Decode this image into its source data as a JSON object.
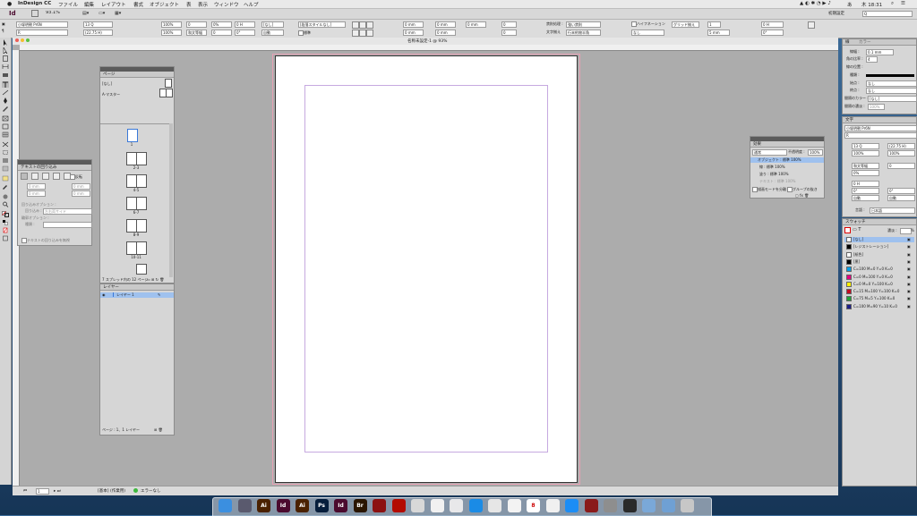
{
  "menubar": {
    "apple": "",
    "app_name": "InDesign CC",
    "items": [
      "ファイル",
      "編集",
      "レイアウト",
      "書式",
      "オブジェクト",
      "表",
      "表示",
      "ウィンドウ",
      "ヘルプ"
    ],
    "clock": "木 18:31",
    "input_method": "あ"
  },
  "app_bar": {
    "logo": "Id",
    "zoom": "93.1%",
    "workspace": "初期設定",
    "search_placeholder": "Q"
  },
  "control_panel": {
    "font_family": "小塚明朝 Pr6N",
    "font_style": "R",
    "font_size": "13 Q",
    "leading": "(22.75 H)",
    "scale_h": "100%",
    "scale_v": "100%",
    "tracking": "0",
    "kerning": "和文等幅",
    "tsume": "0%",
    "aki": "0",
    "baseline": "0 H",
    "skew": "0°",
    "style_none": "[なし]",
    "char_style": "[なし]",
    "stroke_opts": "自動",
    "standard": "標準",
    "para_style": "[段落スタイルなし]",
    "indent_l": "0 mm",
    "indent_r": "0 mm",
    "indent_first": "0 mm",
    "space_before": "0 mm",
    "space_after": "0 mm",
    "drop_lines": "0",
    "drop_chars": "0",
    "kinsoku": "強い禁則",
    "mojikumi": "行末約物半角",
    "hyphen_label": "ハイフネーション",
    "grid_label": "グリッド揃え",
    "align_to": "なし",
    "cols": "1",
    "col_gap": "5 mm",
    "lang_label": "文字揃え"
  },
  "document": {
    "title": "名称未設定-1 @ 93%"
  },
  "statusbar": {
    "page": "1",
    "preflight_label": "[基本] (作業用)",
    "errors": "エラーなし"
  },
  "text_wrap_panel": {
    "title": "テキストの回り込み",
    "invert_label": "反転",
    "offset_top": "0 mm",
    "offset_bottom": "0 mm",
    "offset_left": "0 mm",
    "offset_right": "0 mm",
    "wrap_options_label": "回り込みオプション :",
    "wrap_to_label": "回り込み :",
    "wrap_to_value": "左右両サイド",
    "contour_options_label": "輪郭オプション :",
    "contour_type_label": "種類 :",
    "ignore_label": "テキストの回り込みを無視"
  },
  "pages_panel": {
    "title": "ページ",
    "none_label": "[なし]",
    "master_label": "A-マスター",
    "page_labels": [
      "1",
      "2-3",
      "4-5",
      "6-7",
      "8-9",
      "10-11",
      "12"
    ],
    "footer": "7 スプレッド内の 12 ページ"
  },
  "layers_panel": {
    "title": "レイヤー",
    "layer_name": "レイヤー 1",
    "footer": "ページ : 1、1 レイヤー"
  },
  "effects_panel": {
    "title": "効果",
    "blend_mode": "通常",
    "opacity_label": "不透明度 :",
    "opacity": "100%",
    "rows": [
      {
        "label": "オブジェクト : 標準 100%"
      },
      {
        "label": "線 : 標準 100%"
      },
      {
        "label": "塗り : 標準 100%"
      },
      {
        "label": "テキスト : 標準 100%"
      }
    ],
    "isolate_label": "描画モードを分離",
    "knockout_label": "グループの抜き"
  },
  "stroke_panel": {
    "tab_stroke": "線",
    "tab_color": "カラー",
    "weight_label": "線幅 :",
    "weight": "0.1 mm",
    "miter_label": "角の比率 :",
    "miter": "4",
    "align_label": "線の位置 :",
    "type_label": "種類 :",
    "start_label": "始点 :",
    "start": "なし",
    "end_label": "終点 :",
    "end": "なし",
    "gap_color_label": "間隔のカラー :",
    "gap_color": "[なし]",
    "gap_tint_label": "間隔の濃淡 :",
    "gap_tint": "100%"
  },
  "char_panel": {
    "title": "文字",
    "font": "小塚明朝 Pr6N",
    "style": "R",
    "size": "13 Q",
    "leading": "(22.75 H)",
    "scale_v": "100%",
    "scale_h": "100%",
    "kerning": "和文等幅",
    "tracking": "0",
    "tsume": "0%",
    "baseline": "0 H",
    "skew": "0°",
    "rotate": "0°",
    "aki_before": "自動",
    "aki_after": "自動",
    "lang_label": "言語 :",
    "lang": "日本語"
  },
  "swatches_panel": {
    "title": "スウォッチ",
    "tint_label": "濃淡 :",
    "tint": "%",
    "items": [
      {
        "name": "[なし]",
        "color": "#ffffff"
      },
      {
        "name": "[レジストレーション]",
        "color": "#000000"
      },
      {
        "name": "[紙色]",
        "color": "#ffffff"
      },
      {
        "name": "[黒]",
        "color": "#000000"
      },
      {
        "name": "C=100 M=0 Y=0 K=0",
        "color": "#00a0e9"
      },
      {
        "name": "C=0 M=100 Y=0 K=0",
        "color": "#e4007f"
      },
      {
        "name": "C=0 M=0 Y=100 K=0",
        "color": "#fff100"
      },
      {
        "name": "C=15 M=100 Y=100 K=0",
        "color": "#c30d23"
      },
      {
        "name": "C=75 M=5 Y=100 K=0",
        "color": "#1fa538"
      },
      {
        "name": "C=100 M=90 Y=10 K=0",
        "color": "#1d2088"
      }
    ]
  },
  "dock": {
    "items": [
      {
        "name": "Finder",
        "label": "",
        "color": "#3b8fe0"
      },
      {
        "name": "Launchpad",
        "label": "",
        "color": "#5a5a6e"
      },
      {
        "name": "Illustrator",
        "label": "Ai",
        "color": "#4a2100"
      },
      {
        "name": "InDesign",
        "label": "Id",
        "color": "#4b0a2e"
      },
      {
        "name": "Illustrator",
        "label": "Ai",
        "color": "#4a2100"
      },
      {
        "name": "Photoshop",
        "label": "Ps",
        "color": "#061e3c"
      },
      {
        "name": "InDesign",
        "label": "Id",
        "color": "#4b0a2e"
      },
      {
        "name": "Bridge",
        "label": "Br",
        "color": "#2a1500"
      },
      {
        "name": "Acrobat",
        "label": "",
        "color": "#8c1111"
      },
      {
        "name": "Acrobat Reader",
        "label": "",
        "color": "#b30b00"
      },
      {
        "name": "Preview",
        "label": "",
        "color": "#d8d8d8"
      },
      {
        "name": "TextEdit",
        "label": "",
        "color": "#f1f1f1"
      },
      {
        "name": "Mail",
        "label": "",
        "color": "#e8e8ea"
      },
      {
        "name": "Safari",
        "label": "",
        "color": "#1a8be6"
      },
      {
        "name": "Chrome",
        "label": "",
        "color": "#e6e6e6"
      },
      {
        "name": "Photos",
        "label": "",
        "color": "#f3f3f3"
      },
      {
        "name": "Calendar",
        "label": "8",
        "color": "#ffffff"
      },
      {
        "name": "Music",
        "label": "",
        "color": "#f0f0f0"
      },
      {
        "name": "App Store",
        "label": "",
        "color": "#1c8df5"
      },
      {
        "name": "Photo Booth",
        "label": "",
        "color": "#8a1a1a"
      },
      {
        "name": "Settings",
        "label": "",
        "color": "#8e8e8e"
      },
      {
        "name": "Dashboard",
        "label": "",
        "color": "#2a2a2a"
      },
      {
        "name": "Folder",
        "label": "",
        "color": "#7aa8d8"
      },
      {
        "name": "Downloads",
        "label": "",
        "color": "#6fa0d4"
      },
      {
        "name": "Trash",
        "label": "",
        "color": "#c7c7c7"
      }
    ]
  }
}
